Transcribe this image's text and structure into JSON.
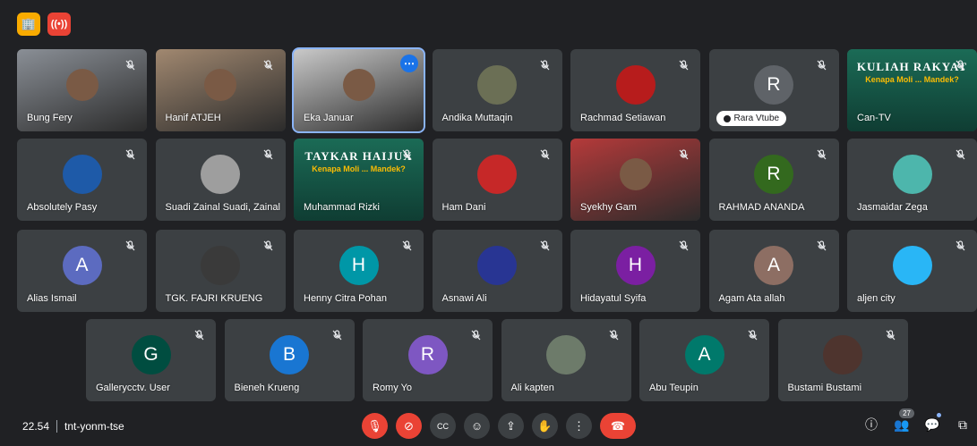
{
  "top_badges": [
    {
      "icon": "building-icon",
      "glyph": "🏢"
    },
    {
      "icon": "live-broadcast-icon",
      "glyph": "((•))"
    }
  ],
  "tiles": [
    {
      "name": "Bung Fery",
      "kind": "photo",
      "color": "#8a8f96"
    },
    {
      "name": "Hanif ATJEH",
      "kind": "photo",
      "color": "#a18870"
    },
    {
      "name": "Eka Januar",
      "kind": "photo",
      "color": "#c9c9c9",
      "selected": true,
      "more": "⋯"
    },
    {
      "name": "Andika Muttaqin",
      "kind": "avatar-photo",
      "color": "#6b6f55"
    },
    {
      "name": "Rachmad Setiawan",
      "kind": "avatar-photo",
      "color": "#b71c1c"
    },
    {
      "name": "Rara Vtube",
      "kind": "letter",
      "letter": "R",
      "color": "#5f6368",
      "pill": true
    },
    {
      "name": "Can-TV",
      "kind": "banner",
      "banner": "KULIAH RAKYAT",
      "sub": "Kenapa Moli ... Mandek?",
      "color": "#1b6b56"
    },
    {
      "name": "Absolutely Pasy",
      "kind": "avatar-photo",
      "color": "#1e5aa8"
    },
    {
      "name": "Suadi Zainal Suadi, Zainal",
      "kind": "avatar-photo",
      "color": "#9e9e9e"
    },
    {
      "name": "Muhammad Rizki",
      "kind": "banner",
      "banner": "TAYKAR HAIJUX",
      "sub": "Kenapa Moli ... Mandek?",
      "color": "#1b6b56"
    },
    {
      "name": "Ham Dani",
      "kind": "avatar-photo",
      "color": "#c62828"
    },
    {
      "name": "Syekhy Gam",
      "kind": "photo",
      "color": "#b53a3a"
    },
    {
      "name": "RAHMAD ANANDA",
      "kind": "letter",
      "letter": "R",
      "color": "#33691e"
    },
    {
      "name": "Jasmaidar Zega",
      "kind": "avatar-photo",
      "color": "#4db6ac"
    },
    {
      "name": "Alias Ismail",
      "kind": "letter",
      "letter": "A",
      "color": "#5c6bc0"
    },
    {
      "name": "TGK. FAJRI KRUENG",
      "kind": "letter",
      "letter": "",
      "color": "#3a3a3a"
    },
    {
      "name": "Henny Citra Pohan",
      "kind": "letter",
      "letter": "H",
      "color": "#0097a7"
    },
    {
      "name": "Asnawi Ali",
      "kind": "avatar-photo",
      "color": "#283593"
    },
    {
      "name": "Hidayatul Syifa",
      "kind": "letter",
      "letter": "H",
      "color": "#7b1fa2"
    },
    {
      "name": "Agam Ata allah",
      "kind": "letter",
      "letter": "A",
      "color": "#8d6e63"
    },
    {
      "name": "aljen city",
      "kind": "avatar-photo",
      "color": "#29b6f6"
    },
    {
      "name": "Gallerycctv. User",
      "kind": "letter",
      "letter": "G",
      "color": "#004d40"
    },
    {
      "name": "Bieneh Krueng",
      "kind": "letter",
      "letter": "B",
      "color": "#1976d2"
    },
    {
      "name": "Romy Yo",
      "kind": "letter",
      "letter": "R",
      "color": "#7e57c2"
    },
    {
      "name": "Ali kapten",
      "kind": "avatar-photo",
      "color": "#6d7b6a"
    },
    {
      "name": "Abu Teupin",
      "kind": "letter",
      "letter": "A",
      "color": "#00796b"
    },
    {
      "name": "Bustami Bustami",
      "kind": "avatar-photo",
      "color": "#4e342e"
    }
  ],
  "footer": {
    "time": "22.54",
    "meeting_code": "tnt-yonm-tse",
    "people_count": "27"
  },
  "controls": [
    {
      "name": "mic-off-button",
      "icon": "mic-off-icon",
      "glyph": "🎙",
      "style": "red"
    },
    {
      "name": "camera-off-button",
      "icon": "camera-off-icon",
      "glyph": "⊘",
      "style": "red"
    },
    {
      "name": "captions-button",
      "icon": "captions-icon",
      "glyph": "CC",
      "style": ""
    },
    {
      "name": "reactions-button",
      "icon": "emoji-icon",
      "glyph": "☺",
      "style": ""
    },
    {
      "name": "present-button",
      "icon": "present-screen-icon",
      "glyph": "⇪",
      "style": ""
    },
    {
      "name": "raise-hand-button",
      "icon": "hand-icon",
      "glyph": "✋",
      "style": ""
    },
    {
      "name": "more-options-button",
      "icon": "more-vert-icon",
      "glyph": "⋮",
      "style": ""
    },
    {
      "name": "leave-call-button",
      "icon": "hangup-icon",
      "glyph": "☎",
      "style": "hangup"
    }
  ],
  "right_controls": [
    {
      "name": "meeting-details-button",
      "icon": "info-icon",
      "glyph": "ⓘ"
    },
    {
      "name": "people-button",
      "icon": "people-icon",
      "glyph": "👥",
      "count": true
    },
    {
      "name": "chat-button",
      "icon": "chat-icon",
      "glyph": "💬",
      "dot": true
    },
    {
      "name": "activities-button",
      "icon": "activities-icon",
      "glyph": "⧉"
    }
  ],
  "colors": {
    "background": "#202124",
    "tile": "#3c4043",
    "danger": "#ea4335",
    "accent": "#1a73e8"
  }
}
